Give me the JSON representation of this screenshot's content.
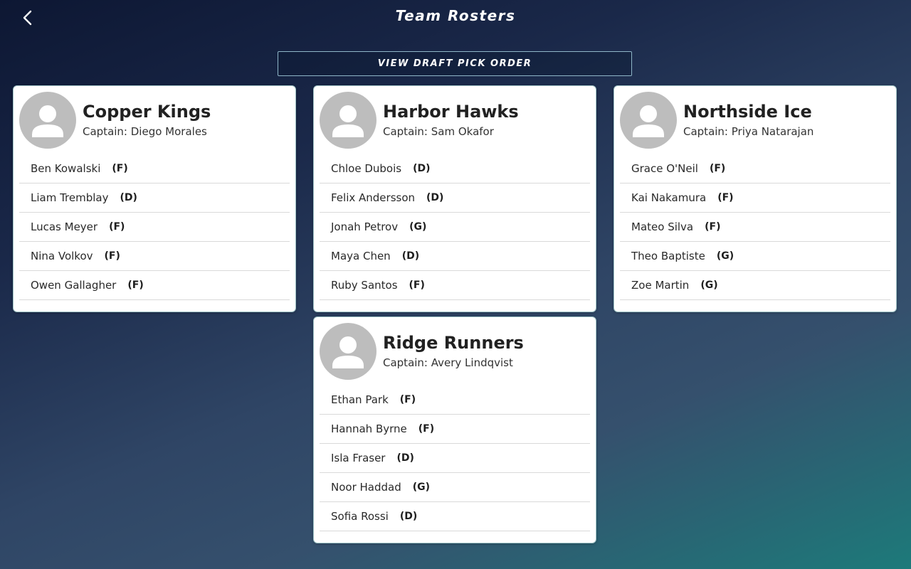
{
  "header": {
    "title": "Team Rosters",
    "back_icon": "chevron-left-icon"
  },
  "draft_button": {
    "label": "VIEW DRAFT PICK ORDER"
  },
  "teams": [
    {
      "name": "Copper Kings",
      "captain": "Captain: Diego Morales",
      "players": [
        {
          "name": "Ben Kowalski",
          "pos": "(F)"
        },
        {
          "name": "Liam Tremblay",
          "pos": "(D)"
        },
        {
          "name": "Lucas Meyer",
          "pos": "(F)"
        },
        {
          "name": "Nina Volkov",
          "pos": "(F)"
        },
        {
          "name": "Owen Gallagher",
          "pos": "(F)"
        }
      ]
    },
    {
      "name": "Harbor Hawks",
      "captain": "Captain: Sam Okafor",
      "players": [
        {
          "name": "Chloe Dubois",
          "pos": "(D)"
        },
        {
          "name": "Felix Andersson",
          "pos": "(D)"
        },
        {
          "name": "Jonah Petrov",
          "pos": "(G)"
        },
        {
          "name": "Maya Chen",
          "pos": "(D)"
        },
        {
          "name": "Ruby Santos",
          "pos": "(F)"
        }
      ]
    },
    {
      "name": "Northside Ice",
      "captain": "Captain: Priya Natarajan",
      "players": [
        {
          "name": "Grace O'Neil",
          "pos": "(F)"
        },
        {
          "name": "Kai Nakamura",
          "pos": "(F)"
        },
        {
          "name": "Mateo Silva",
          "pos": "(F)"
        },
        {
          "name": "Theo Baptiste",
          "pos": "(G)"
        },
        {
          "name": "Zoe Martin",
          "pos": "(G)"
        }
      ]
    },
    {
      "name": "Ridge Runners",
      "captain": "Captain: Avery Lindqvist",
      "players": [
        {
          "name": "Ethan Park",
          "pos": "(F)"
        },
        {
          "name": "Hannah Byrne",
          "pos": "(F)"
        },
        {
          "name": "Isla Fraser",
          "pos": "(D)"
        },
        {
          "name": "Noor Haddad",
          "pos": "(G)"
        },
        {
          "name": "Sofia Rossi",
          "pos": "(D)"
        }
      ]
    }
  ],
  "colors": {
    "avatar_bg": "#bdbdbd",
    "card_border": "#9fc3c6",
    "button_border": "#8fb6c8"
  }
}
